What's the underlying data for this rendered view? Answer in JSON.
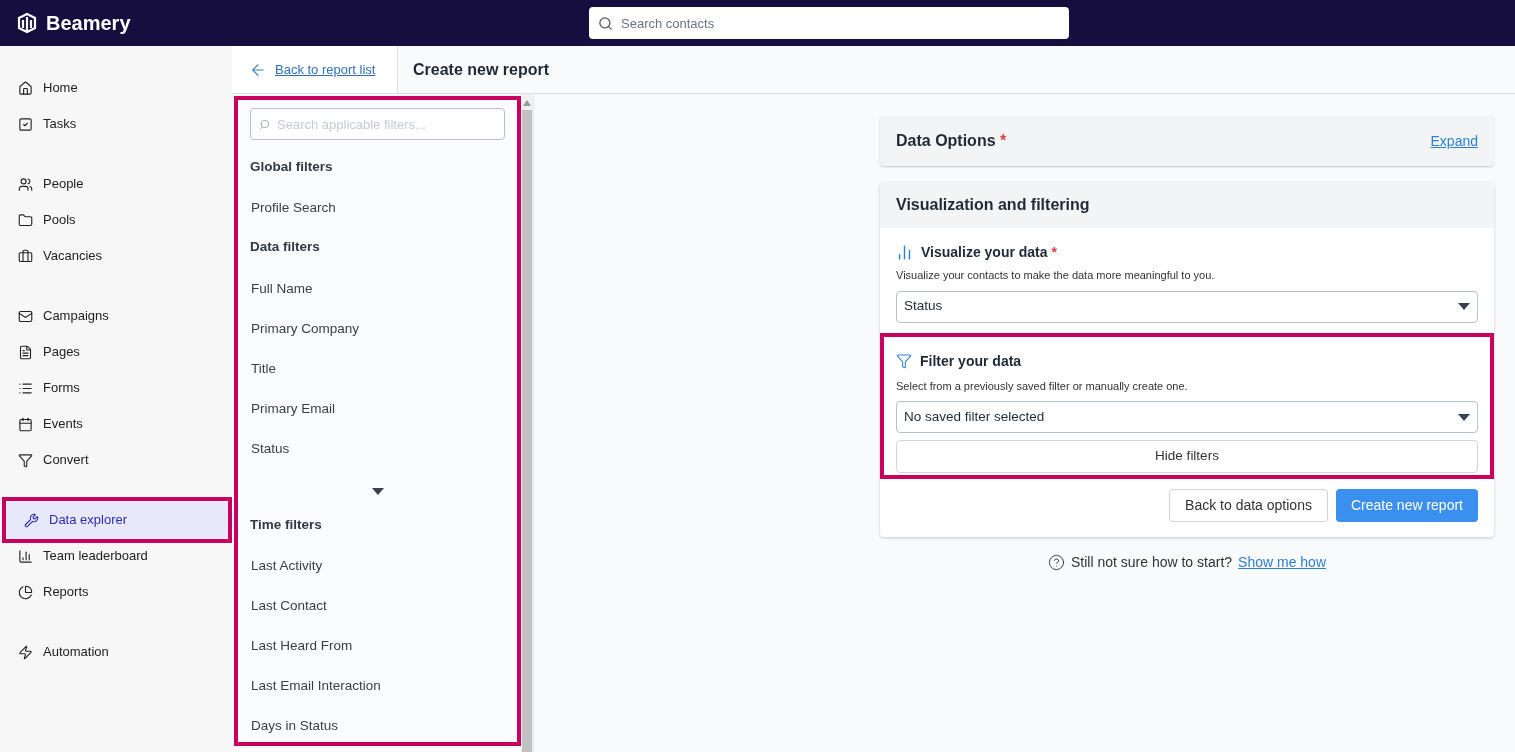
{
  "brand": {
    "name": "Beamery"
  },
  "search": {
    "placeholder": "Search contacts"
  },
  "nav_groups": [
    [
      {
        "label": "Home",
        "selected": false,
        "highlighted": false
      },
      {
        "label": "Tasks",
        "selected": false,
        "highlighted": false
      }
    ],
    [
      {
        "label": "People",
        "selected": false,
        "highlighted": false
      },
      {
        "label": "Pools",
        "selected": false,
        "highlighted": false
      },
      {
        "label": "Vacancies",
        "selected": false,
        "highlighted": false
      }
    ],
    [
      {
        "label": "Campaigns",
        "selected": false,
        "highlighted": false
      },
      {
        "label": "Pages",
        "selected": false,
        "highlighted": false
      },
      {
        "label": "Forms",
        "selected": false,
        "highlighted": false
      },
      {
        "label": "Events",
        "selected": false,
        "highlighted": false
      },
      {
        "label": "Convert",
        "selected": false,
        "highlighted": false
      }
    ],
    [
      {
        "label": "Data explorer",
        "selected": true,
        "highlighted": true
      },
      {
        "label": "Team leaderboard",
        "selected": false,
        "highlighted": false
      },
      {
        "label": "Reports",
        "selected": false,
        "highlighted": false
      }
    ],
    [
      {
        "label": "Automation",
        "selected": false,
        "highlighted": false
      }
    ]
  ],
  "back_link": "Back to report list",
  "page_title": "Create new report",
  "filters_panel": {
    "highlighted": true,
    "search_placeholder": "Search applicable filters...",
    "sections": [
      {
        "heading": "Global filters",
        "items": [
          "Profile Search"
        ],
        "more": false
      },
      {
        "heading": "Data filters",
        "items": [
          "Full Name",
          "Primary Company",
          "Title",
          "Primary Email",
          "Status"
        ],
        "more": true
      },
      {
        "heading": "Time filters",
        "items": [
          "Last Activity",
          "Last Contact",
          "Last Heard From",
          "Last Email Interaction",
          "Days in Status"
        ],
        "more": false
      }
    ]
  },
  "data_options": {
    "title": "Data Options",
    "required": "*",
    "action": "Expand"
  },
  "visualization": {
    "title": "Visualization and filtering",
    "visualize": {
      "title": "Visualize your data",
      "required": "*",
      "description": "Visualize your contacts to make the data more meaningful to you.",
      "value": "Status"
    },
    "filter": {
      "highlighted": true,
      "title": "Filter your data",
      "description": "Select from a previously saved filter or manually create one.",
      "value": "No saved filter selected",
      "toggle": "Hide filters"
    },
    "buttons": [
      {
        "label": "Back to data options",
        "kind": "secondary"
      },
      {
        "label": "Create new report",
        "kind": "primary"
      }
    ]
  },
  "help": {
    "text": "Still not sure how to start?",
    "link": "Show me how"
  }
}
